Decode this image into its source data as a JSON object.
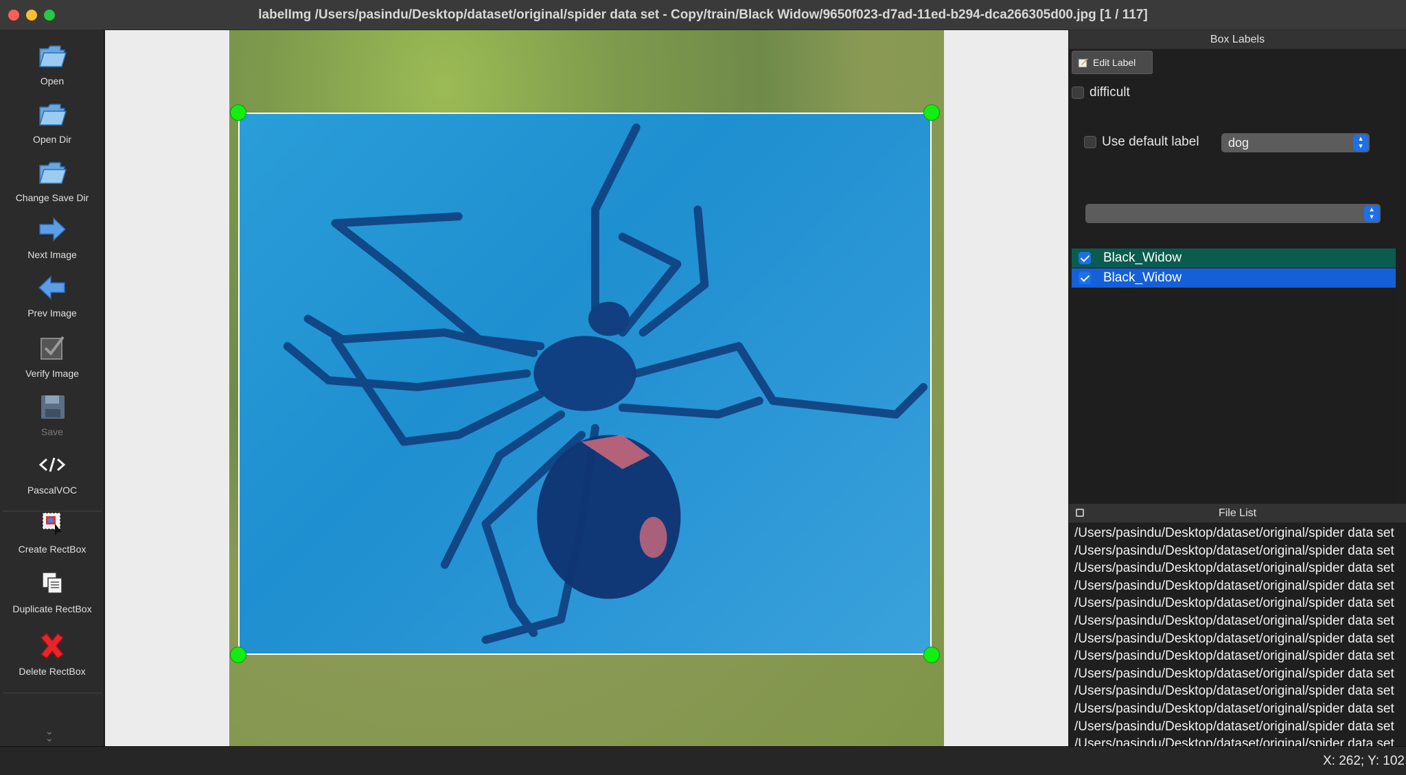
{
  "window": {
    "title": "labelImg /Users/pasindu/Desktop/dataset/original/spider data set - Copy/train/Black Widow/9650f023-d7ad-11ed-b294-dca266305d00.jpg [1 / 117]"
  },
  "toolbar": {
    "items": [
      {
        "label": "Open",
        "icon": "folder-open-icon",
        "enabled": true
      },
      {
        "label": "Open Dir",
        "icon": "folder-open-icon",
        "enabled": true
      },
      {
        "label": "Change Save Dir",
        "icon": "folder-open-icon",
        "enabled": true
      },
      {
        "label": "Next Image",
        "icon": "arrow-right-icon",
        "enabled": true
      },
      {
        "label": "Prev Image",
        "icon": "arrow-left-icon",
        "enabled": true
      },
      {
        "label": "Verify Image",
        "icon": "checkbox-icon",
        "enabled": true
      },
      {
        "label": "Save",
        "icon": "floppy-disk-icon",
        "enabled": false
      },
      {
        "label": "PascalVOC",
        "icon": "code-icon",
        "enabled": true
      },
      {
        "label": "Create RectBox",
        "icon": "create-rect-icon",
        "enabled": true
      },
      {
        "label": "Duplicate RectBox",
        "icon": "duplicate-icon",
        "enabled": true
      },
      {
        "label": "Delete RectBox",
        "icon": "red-x-icon",
        "enabled": true
      }
    ],
    "expand_icon": "chevron-double-down-icon"
  },
  "box_labels": {
    "title": "Box Labels",
    "edit_label": "Edit Label",
    "difficult_label": "difficult",
    "difficult_checked": false,
    "use_default_label": "Use default label",
    "use_default_checked": false,
    "default_label_value": "dog",
    "label_filter_value": "",
    "labels": [
      {
        "name": "Black_Widow",
        "checked": true,
        "color": "#0a5c4f"
      },
      {
        "name": "Black_Widow",
        "checked": true,
        "color": "#1560d8"
      }
    ]
  },
  "file_list": {
    "title": "File List",
    "files": [
      "/Users/pasindu/Desktop/dataset/original/spider data set",
      "/Users/pasindu/Desktop/dataset/original/spider data set",
      "/Users/pasindu/Desktop/dataset/original/spider data set",
      "/Users/pasindu/Desktop/dataset/original/spider data set",
      "/Users/pasindu/Desktop/dataset/original/spider data set",
      "/Users/pasindu/Desktop/dataset/original/spider data set",
      "/Users/pasindu/Desktop/dataset/original/spider data set",
      "/Users/pasindu/Desktop/dataset/original/spider data set",
      "/Users/pasindu/Desktop/dataset/original/spider data set",
      "/Users/pasindu/Desktop/dataset/original/spider data set",
      "/Users/pasindu/Desktop/dataset/original/spider data set",
      "/Users/pasindu/Desktop/dataset/original/spider data set",
      "/Users/pasindu/Desktop/dataset/original/spider data set"
    ]
  },
  "status": {
    "coords": "X: 262; Y: 102"
  },
  "colors": {
    "accent": "#1e6fe8",
    "box_fill": "#1e8fd0",
    "handle": "#11ee11"
  }
}
